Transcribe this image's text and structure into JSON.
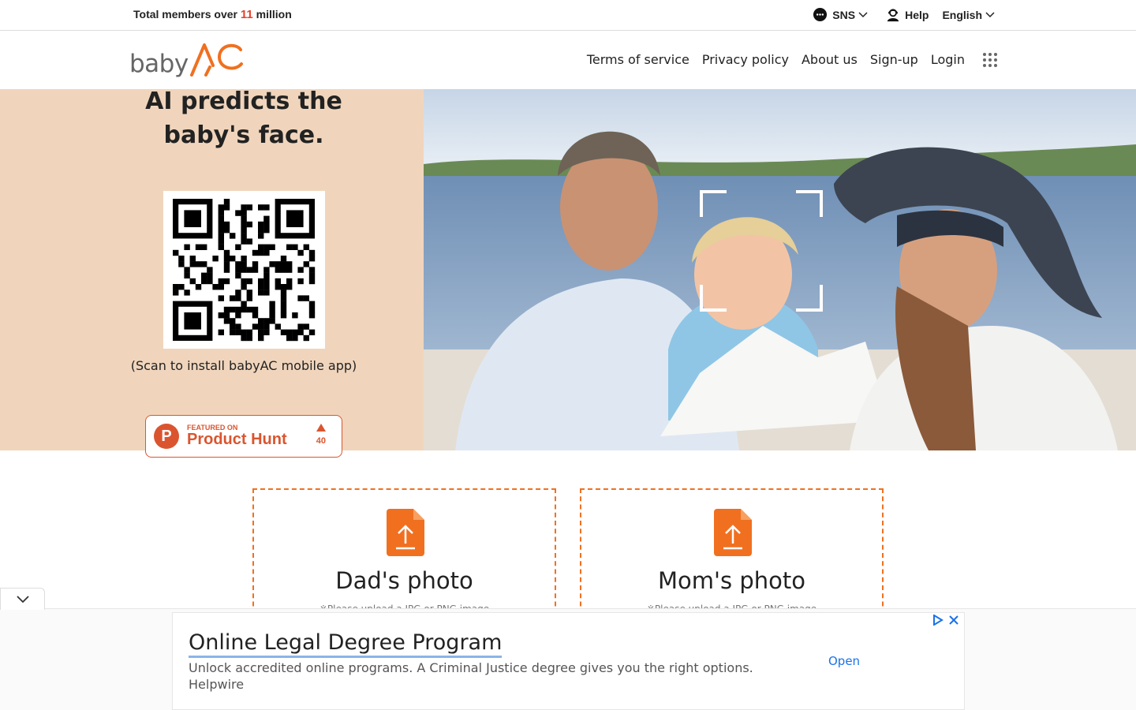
{
  "topbar": {
    "members_prefix": "Total members over ",
    "members_number": "11",
    "members_suffix": " million",
    "sns_label": "SNS",
    "help_label": "Help",
    "language_label": "English"
  },
  "header": {
    "logo_text": "baby",
    "logo_mark": "AC",
    "nav": [
      "Terms of service",
      "Privacy policy",
      "About us",
      "Sign-up",
      "Login"
    ],
    "menu_icon": "grid-icon"
  },
  "hero": {
    "title_line1": "AI predicts the",
    "title_line2": "baby's face.",
    "scan_text": "(Scan to install babyAC mobile app)",
    "product_hunt": {
      "small": "FEATURED ON",
      "big": "Product Hunt",
      "votes": "40",
      "logo_letter": "P"
    }
  },
  "upload": {
    "dad_label": "Dad's photo",
    "mom_label": "Mom's photo",
    "hint": "※Please upload a JPG or PNG image"
  },
  "ad": {
    "title": "Online Legal Degree Program",
    "description": "Unlock accredited online programs. A Criminal Justice degree gives you the right options.",
    "source": "Helpwire",
    "cta": "Open"
  },
  "colors": {
    "accent": "#f07020",
    "hero_bg": "#f0d5bc",
    "members_number": "#e8402a",
    "product_hunt": "#da552f"
  }
}
